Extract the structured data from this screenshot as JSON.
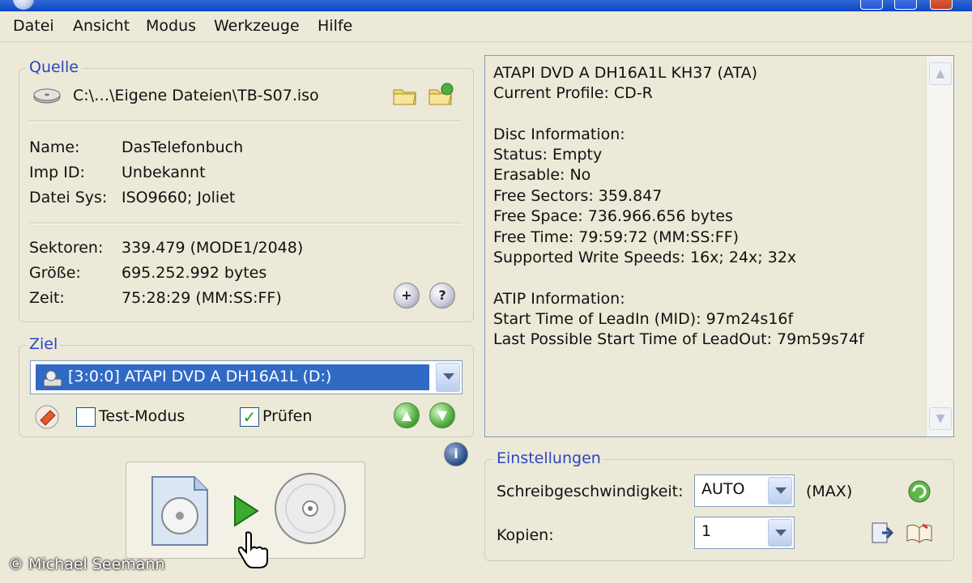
{
  "menu": [
    "Datei",
    "Ansicht",
    "Modus",
    "Werkzeuge",
    "Hilfe"
  ],
  "source": {
    "label": "Quelle",
    "path": "C:\\…\\Eigene Dateien\\TB-S07.iso",
    "props": [
      {
        "key": "Name:",
        "value": "DasTelefonbuch"
      },
      {
        "key": "Imp ID:",
        "value": "Unbekannt"
      },
      {
        "key": "Datei Sys:",
        "value": "ISO9660; Joliet"
      }
    ],
    "stats": [
      {
        "key": "Sektoren:",
        "value": "339.479 (MODE1/2048)"
      },
      {
        "key": "Größe:",
        "value": "695.252.992 bytes"
      },
      {
        "key": "Zeit:",
        "value": "75:28:29 (MM:SS:FF)"
      }
    ]
  },
  "target": {
    "label": "Ziel",
    "drive": "[3:0:0] ATAPI DVD A  DH16A1L (D:)",
    "test_mode_label": "Test-Modus",
    "test_mode_checked": false,
    "verify_label": "Prüfen",
    "verify_checked": true
  },
  "info": {
    "lines": [
      "ATAPI DVD A  DH16A1L KH37 (ATA)",
      "Current Profile: CD-R",
      "",
      "Disc Information:",
      "Status: Empty",
      "Erasable: No",
      "Free Sectors: 359.847",
      "Free Space: 736.966.656 bytes",
      "Free Time: 79:59:72 (MM:SS:FF)",
      "Supported Write Speeds: 16x; 24x; 32x",
      "",
      "ATIP Information:",
      "Start Time of LeadIn (MID): 97m24s16f",
      "Last Possible Start Time of LeadOut: 79m59s74f"
    ]
  },
  "settings": {
    "label": "Einstellungen",
    "speed_label": "Schreibgeschwindigkeit:",
    "speed_value": "AUTO",
    "speed_max": "(MAX)",
    "copies_label": "Kopien:",
    "copies_value": "1"
  },
  "watermark": "© Michael Seemann"
}
